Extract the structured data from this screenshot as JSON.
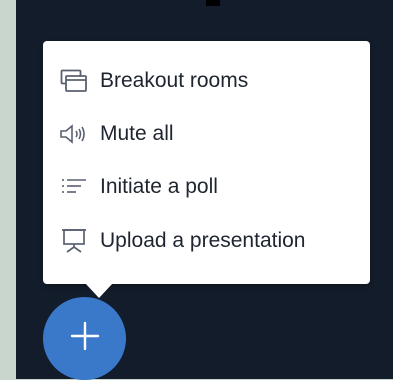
{
  "menu": {
    "items": [
      {
        "label": "Breakout rooms",
        "icon": "breakout-rooms-icon"
      },
      {
        "label": "Mute all",
        "icon": "speaker-mute-icon"
      },
      {
        "label": "Initiate a poll",
        "icon": "poll-list-icon"
      },
      {
        "label": "Upload a presentation",
        "icon": "presentation-icon"
      }
    ]
  },
  "fab": {
    "icon": "plus-icon"
  },
  "colors": {
    "background": "#c9d6cd",
    "panel": "#131c2a",
    "menu": "#ffffff",
    "text": "#1e2530",
    "icon": "#596170",
    "fab": "#3a78c9"
  }
}
